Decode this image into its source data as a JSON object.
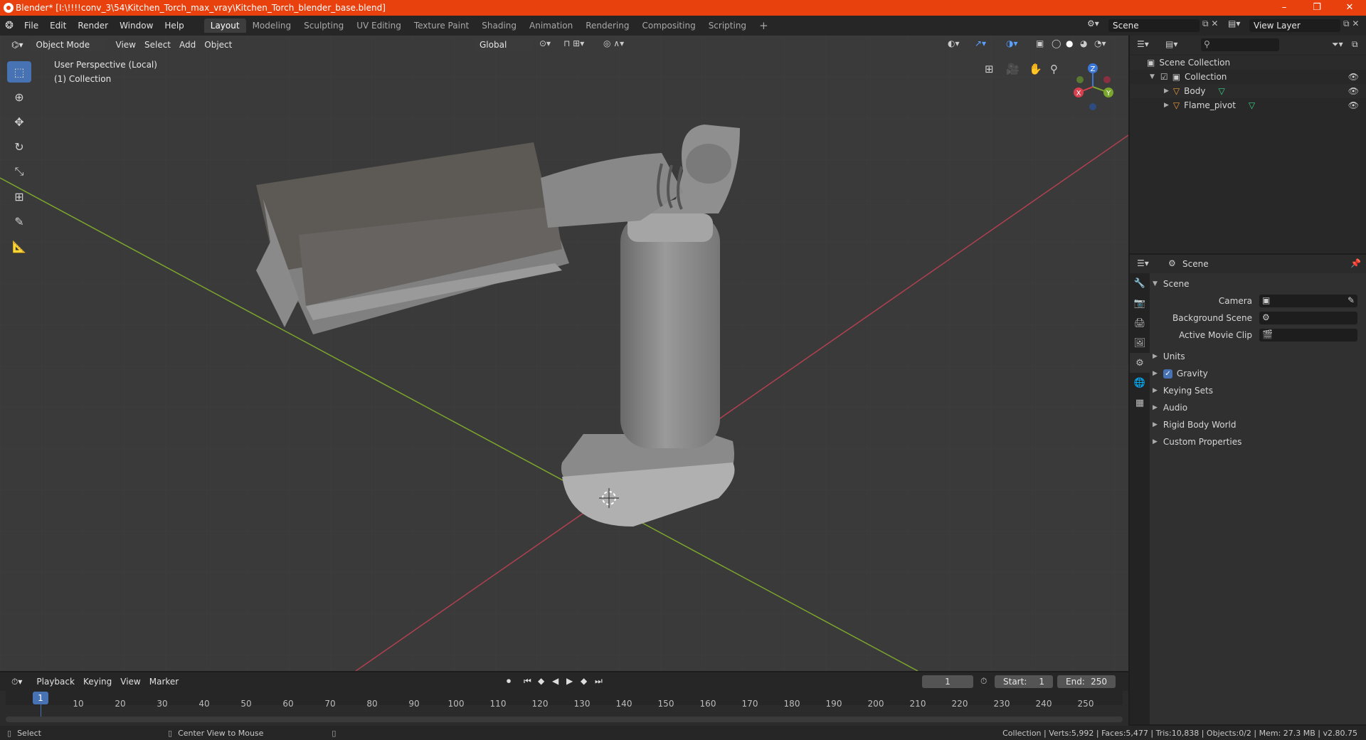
{
  "title_bar": {
    "title": "Blender* [I:\\!!!!conv_3\\54\\Kitchen_Torch_max_vray\\Kitchen_Torch_blender_base.blend]",
    "minimize": "–",
    "maximize": "❐",
    "close": "✕"
  },
  "menu": [
    "File",
    "Edit",
    "Render",
    "Window",
    "Help"
  ],
  "workspaces": [
    "Layout",
    "Modeling",
    "Sculpting",
    "UV Editing",
    "Texture Paint",
    "Shading",
    "Animation",
    "Rendering",
    "Compositing",
    "Scripting"
  ],
  "add_workspace": "+",
  "scene_selector": "Scene",
  "view_layer": "View Layer",
  "viewport": {
    "mode": "Object Mode",
    "menus": [
      "View",
      "Select",
      "Add",
      "Object"
    ],
    "orientation": "Global",
    "info_line1": "User Perspective (Local)",
    "info_line2": "(1) Collection",
    "gizmo": {
      "z": "Z",
      "y": "Y",
      "x": "X"
    }
  },
  "outliner": {
    "search_placeholder": "",
    "root": "Scene Collection",
    "collection": "Collection",
    "items": [
      "Body",
      "Flame_pivot"
    ]
  },
  "properties": {
    "header": "Scene",
    "section": "Scene",
    "camera_label": "Camera",
    "background_scene_label": "Background Scene",
    "active_movie_clip_label": "Active Movie Clip",
    "panels": [
      "Units",
      "Gravity",
      "Keying Sets",
      "Audio",
      "Rigid Body World",
      "Custom Properties"
    ],
    "gravity_checked": true
  },
  "timeline": {
    "menus": [
      "Playback",
      "Keying",
      "View",
      "Marker"
    ],
    "current_frame": "1",
    "start_label": "Start:",
    "start": "1",
    "end_label": "End:",
    "end": "250",
    "ticks": [
      "1",
      "10",
      "20",
      "30",
      "40",
      "50",
      "60",
      "70",
      "80",
      "90",
      "100",
      "110",
      "120",
      "130",
      "140",
      "150",
      "160",
      "170",
      "180",
      "190",
      "200",
      "210",
      "220",
      "230",
      "240",
      "250"
    ]
  },
  "status": {
    "left1": "Select",
    "left2": "Center View to Mouse",
    "right": "Collection | Verts:5,992 | Faces:5,477 | Tris:10,838 | Objects:0/2 | Mem: 27.3 MB | v2.80.75"
  },
  "colors": {
    "accent": "#4772b3",
    "title_bar": "#e8410e",
    "x_axis": "#d8404f",
    "y_axis": "#7ba62c",
    "z_axis": "#3a77d8"
  }
}
